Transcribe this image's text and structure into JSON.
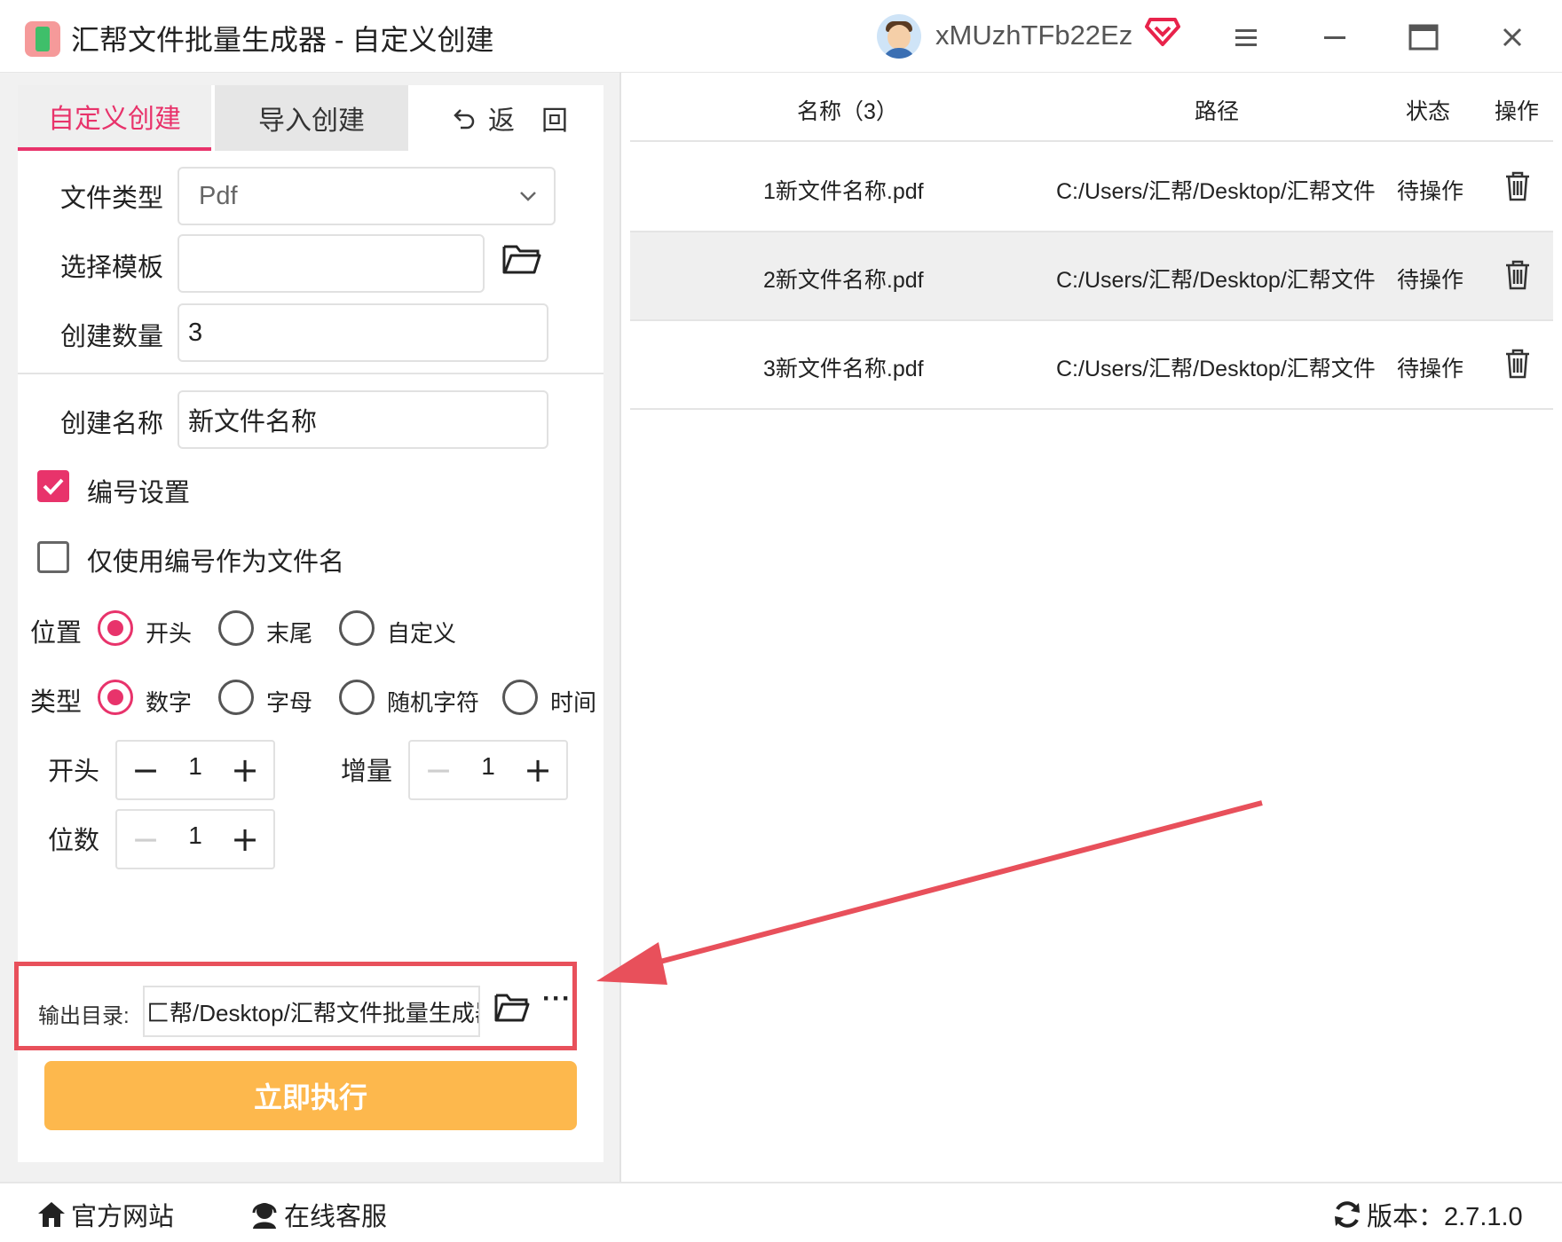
{
  "window": {
    "title": "汇帮文件批量生成器 - 自定义创建",
    "username": "xMUzhTFb22Ez",
    "icons": [
      "app-logo-icon",
      "avatar",
      "vip-diamond-icon",
      "menu-icon",
      "minimize-icon",
      "maximize-icon",
      "close-icon"
    ]
  },
  "tabs": {
    "custom": "自定义创建",
    "import": "导入创建",
    "back": "返　回"
  },
  "form": {
    "file_type_label": "文件类型",
    "file_type_value": "Pdf",
    "template_label": "选择模板",
    "template_value": "",
    "count_label": "创建数量",
    "count_value": "3",
    "name_label": "创建名称",
    "name_value": "新文件名称"
  },
  "numbering": {
    "enable_label": "编号设置",
    "enable_checked": true,
    "only_number_label": "仅使用编号作为文件名",
    "only_number_checked": false,
    "position_label": "位置",
    "position_options": [
      "开头",
      "末尾",
      "自定义"
    ],
    "position_selected": "开头",
    "type_label": "类型",
    "type_options": [
      "数字",
      "字母",
      "随机字符",
      "时间"
    ],
    "type_selected": "数字",
    "start_label": "开头",
    "start_value": "1",
    "increment_label": "增量",
    "increment_value": "1",
    "digits_label": "位数",
    "digits_value": "1"
  },
  "output": {
    "label": "输出目录:",
    "path": "匚帮/Desktop/汇帮文件批量生成器",
    "more": "···"
  },
  "execute_label": "立即执行",
  "table": {
    "headers": {
      "name": "名称（3）",
      "path": "路径",
      "status": "状态",
      "action": "操作"
    },
    "rows": [
      {
        "name": "1新文件名称.pdf",
        "path": "C:/Users/汇帮/Desktop/汇帮文件",
        "status": "待操作"
      },
      {
        "name": "2新文件名称.pdf",
        "path": "C:/Users/汇帮/Desktop/汇帮文件",
        "status": "待操作"
      },
      {
        "name": "3新文件名称.pdf",
        "path": "C:/Users/汇帮/Desktop/汇帮文件",
        "status": "待操作"
      }
    ]
  },
  "footer": {
    "website": "官方网站",
    "support": "在线客服",
    "version": "版本：2.7.1.0"
  },
  "colors": {
    "accent": "#e8336b",
    "execute": "#fdb84d",
    "highlight_box": "#e8505b"
  }
}
